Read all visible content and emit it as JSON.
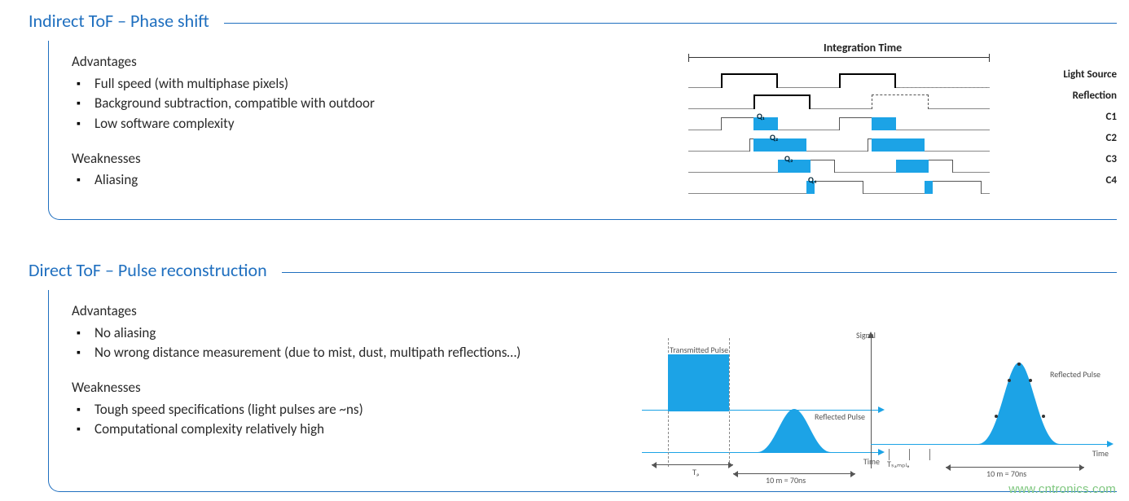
{
  "panels": [
    {
      "title": "Indirect ToF – Phase shift",
      "advantages_label": "Advantages",
      "advantages": [
        "Full speed (with multiphase pixels)",
        "Background subtraction, compatible with outdoor",
        "Low software complexity"
      ],
      "weaknesses_label": "Weaknesses",
      "weaknesses": [
        "Aliasing"
      ]
    },
    {
      "title": "Direct ToF – Pulse reconstruction",
      "advantages_label": "Advantages",
      "advantages": [
        "No aliasing",
        "No wrong distance measurement  (due to mist, dust, multipath reflections…)"
      ],
      "weaknesses_label": "Weaknesses",
      "weaknesses": [
        "Tough speed specifications (light pulses are ~ns)",
        "Computational complexity relatively high"
      ]
    }
  ],
  "diagram_top": {
    "title": "Integration Time",
    "row_labels": [
      "Light Source",
      "Reflection",
      "C1",
      "C2",
      "C3",
      "C4"
    ],
    "q_labels": [
      "Q₁",
      "Q₂",
      "Q₃",
      "Q₄"
    ]
  },
  "diagram_bl": {
    "tx_label": "Transmitted Pulse",
    "rx_label": "Reflected Pulse",
    "tlabel": "Tᵨ",
    "time_label": "Time",
    "meas_label": "10 m = 70ns"
  },
  "diagram_br": {
    "ylabel": "Signal",
    "rx_label": "Reflected Pulse",
    "time_label": "Time",
    "sample_label": "Tₛₐₘₚₗₑ",
    "meas_label": "10 m = 70ns"
  },
  "watermark": "www.cntronics.com"
}
